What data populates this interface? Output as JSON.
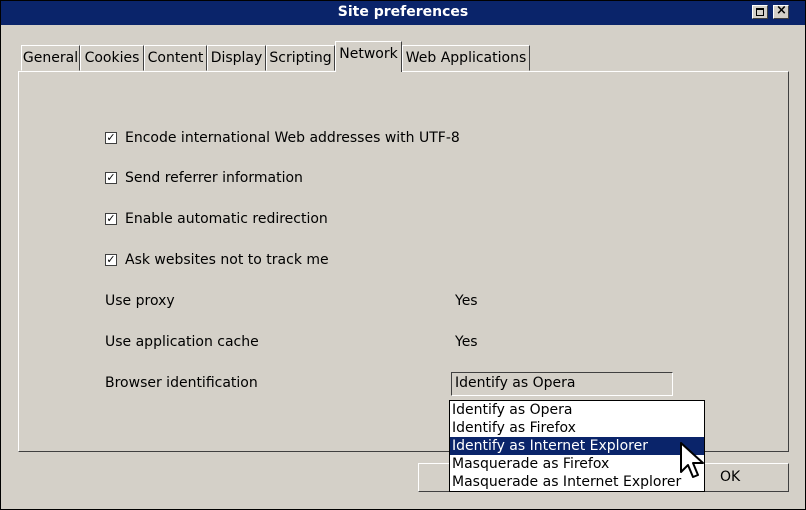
{
  "window": {
    "title": "Site preferences"
  },
  "tabs": [
    {
      "label": "General"
    },
    {
      "label": "Cookies"
    },
    {
      "label": "Content"
    },
    {
      "label": "Display"
    },
    {
      "label": "Scripting"
    },
    {
      "label": "Network",
      "active": true
    },
    {
      "label": "Web Applications"
    }
  ],
  "checkboxes": [
    {
      "label": "Encode international Web addresses with UTF-8",
      "checked": true
    },
    {
      "label": "Send referrer information",
      "checked": true
    },
    {
      "label": "Enable automatic redirection",
      "checked": true
    },
    {
      "label": "Ask websites not to track me",
      "checked": true
    }
  ],
  "settings": {
    "proxy": {
      "label": "Use proxy",
      "value": "Yes"
    },
    "cache": {
      "label": "Use application cache",
      "value": "Yes"
    },
    "browser_id": {
      "label": "Browser identification",
      "value": "Identify as Opera"
    }
  },
  "browser_id_options": [
    {
      "label": "Identify as Opera"
    },
    {
      "label": "Identify as Firefox"
    },
    {
      "label": "Identify as Internet Explorer",
      "highlighted": true
    },
    {
      "label": "Masquerade as Firefox"
    },
    {
      "label": "Masquerade as Internet Explorer"
    }
  ],
  "buttons": {
    "ok_label": "OK"
  },
  "colors": {
    "titlebar": "#0a246a",
    "face": "#d4d0c8",
    "highlight": "#0a246a"
  },
  "icons": {
    "maximize": "maximize-icon",
    "close": "close-icon",
    "check": "checkmark-icon",
    "cursor": "mouse-pointer-icon"
  }
}
